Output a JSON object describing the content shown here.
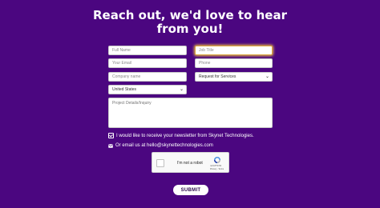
{
  "header": {
    "title_line1": "Reach out, we'd love to hear",
    "title_line2": "from you!"
  },
  "form": {
    "full_name": {
      "placeholder": "Full Name",
      "value": ""
    },
    "job_title": {
      "placeholder": "Job Title",
      "value": ""
    },
    "email": {
      "placeholder": "Your Email",
      "value": ""
    },
    "phone": {
      "placeholder": "Phone",
      "value": ""
    },
    "company": {
      "placeholder": "Company name",
      "value": ""
    },
    "service": {
      "selected": "Request for Services"
    },
    "country": {
      "selected": "United States"
    },
    "details": {
      "placeholder": "Project Details/Inquiry",
      "value": ""
    },
    "newsletter": {
      "label": "I would like to receive your newsletter from Skynet Technologies.",
      "checked": true
    },
    "email_contact": {
      "text": "Or email us at hello@skynettechnologies.com"
    },
    "recaptcha": {
      "label": "I'm not a robot",
      "brand": "reCAPTCHA",
      "terms": "Privacy - Terms"
    },
    "submit_label": "SUBMIT"
  },
  "colors": {
    "background": "#4b0680",
    "focus_highlight": "#e8b84a",
    "text_white": "#ffffff"
  },
  "icons": {
    "checkbox": "checkmark-icon",
    "email": "envelope-icon",
    "select_arrow": "chevron-down-icon",
    "recaptcha": "recaptcha-logo-icon"
  }
}
